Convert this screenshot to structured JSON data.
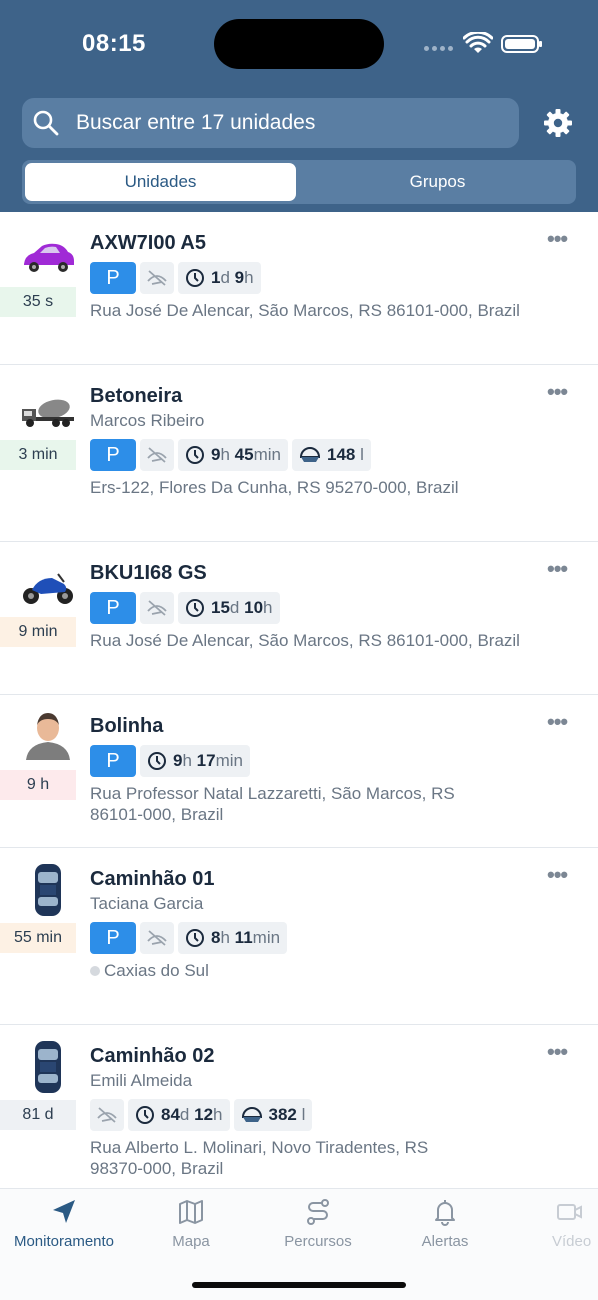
{
  "status": {
    "time": "08:15"
  },
  "search": {
    "placeholder": "Buscar entre 17 unidades"
  },
  "segments": [
    {
      "label": "Unidades",
      "selected": true
    },
    {
      "label": "Grupos",
      "selected": false
    }
  ],
  "units": [
    {
      "name": "AXW7I00 A5",
      "driver": "",
      "age": "35 s",
      "parking": "P",
      "no_signal": true,
      "duration": {
        "d_num": "1",
        "d_unit": "d",
        "h_num": "9",
        "h_unit": "h"
      },
      "fuel": null,
      "address": "Rua José De Alencar, São Marcos, RS 86101-000, Brazil",
      "icon": "purple-car-icon"
    },
    {
      "name": "Betoneira",
      "driver": "Marcos Ribeiro",
      "age": "3 min",
      "parking": "P",
      "no_signal": true,
      "duration": {
        "d_num": "9",
        "d_unit": "h",
        "h_num": "45",
        "h_unit": "min"
      },
      "fuel": {
        "value": "148",
        "unit": "l"
      },
      "address": "Ers-122, Flores Da Cunha, RS 95270-000, Brazil",
      "icon": "concrete-mixer-truck-icon"
    },
    {
      "name": "BKU1I68 GS",
      "driver": "",
      "age": "9 min",
      "parking": "P",
      "no_signal": true,
      "duration": {
        "d_num": "15",
        "d_unit": "d",
        "h_num": "10",
        "h_unit": "h"
      },
      "fuel": null,
      "address": "Rua José De Alencar, São Marcos, RS 86101-000, Brazil",
      "icon": "motorcycle-icon"
    },
    {
      "name": "Bolinha",
      "driver": "",
      "age": "9 h",
      "parking": "P",
      "no_signal": false,
      "duration": {
        "d_num": "9",
        "d_unit": "h",
        "h_num": "17",
        "h_unit": "min"
      },
      "fuel": null,
      "address_line1": "Rua Professor Natal Lazzaretti, São Marcos, RS",
      "address_line2": "86101-000, Brazil",
      "icon": "person-avatar-icon"
    },
    {
      "name": "Caminhão 01",
      "driver": "Taciana Garcia",
      "age": "55 min",
      "parking": "P",
      "no_signal": true,
      "duration": {
        "d_num": "8",
        "d_unit": "h",
        "h_num": "11",
        "h_unit": "min"
      },
      "fuel": null,
      "address": "Caxias do Sul",
      "icon": "blue-car-top-icon"
    },
    {
      "name": "Caminhão 02",
      "driver": "Emili Almeida",
      "age": "81 d",
      "parking": "",
      "no_signal": true,
      "duration": {
        "d_num": "84",
        "d_unit": "d",
        "h_num": "12",
        "h_unit": "h"
      },
      "fuel": {
        "value": "382",
        "unit": "l"
      },
      "address_line1": "Rua Alberto L. Molinari, Novo Tiradentes, RS",
      "address_line2": "98370-000, Brazil",
      "icon": "blue-car-top-icon"
    }
  ],
  "tabs": [
    {
      "label": "Monitoramento",
      "icon": "navigation-arrow-icon",
      "active": true
    },
    {
      "label": "Mapa",
      "icon": "map-icon",
      "active": false
    },
    {
      "label": "Percursos",
      "icon": "route-icon",
      "active": false
    },
    {
      "label": "Alertas",
      "icon": "bell-icon",
      "active": false
    },
    {
      "label": "Vídeo",
      "icon": "video-icon",
      "active": false
    }
  ],
  "colors": {
    "header": "#3e6389",
    "accent": "#2d8ee8",
    "active_tab": "#2b5a84"
  }
}
